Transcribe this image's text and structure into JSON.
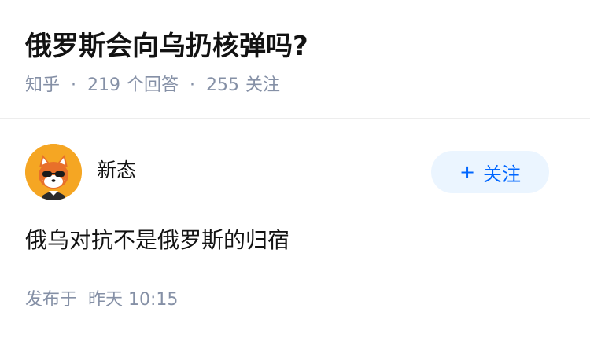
{
  "question": {
    "title": "俄罗斯会向乌扔核弹吗?",
    "source": "知乎",
    "separator": "·",
    "answer_count": "219",
    "answer_label": "个回答",
    "follower_count": "255",
    "follower_label": "关注"
  },
  "answer": {
    "author_name": "新态",
    "follow_label": "关注",
    "follow_icon": "plus-icon",
    "excerpt": "俄乌对抗不是俄罗斯的归宿",
    "publish_label": "发布于",
    "publish_time": "昨天 10:15"
  },
  "colors": {
    "accent": "#0066ff",
    "follow_bg": "#ebf5ff",
    "meta_gray": "#8590a6",
    "avatar_orange": "#f5a623"
  }
}
